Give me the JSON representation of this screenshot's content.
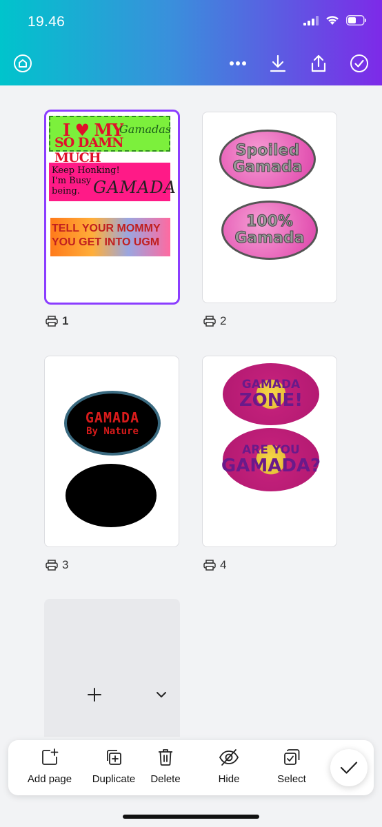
{
  "status_bar": {
    "time": "19.46"
  },
  "pages": [
    {
      "number": "1",
      "selected": true
    },
    {
      "number": "2",
      "selected": false
    },
    {
      "number": "3",
      "selected": false
    },
    {
      "number": "4",
      "selected": false
    }
  ],
  "page1": {
    "sticker1_line1": "I ♥ MY",
    "sticker1_script": "Gamadas",
    "sticker1_line2": "SO DAMN MUCH",
    "sticker2_text": "Keep Honking!\nI'm Busy\nbeing.",
    "sticker2_script": "GAMADA",
    "sticker3_text": "TELL YOUR MOMMY\nYOU GET INTO UGM"
  },
  "page2": {
    "oval1_line1": "Spoiled",
    "oval1_line2": "Gamada",
    "oval2_line1": "100%",
    "oval2_line2": "Gamada"
  },
  "page3": {
    "oval1_line1": "GAMADA",
    "oval1_line2": "By Nature"
  },
  "page4": {
    "oval1_line1": "GAMADA",
    "oval1_line2": "ZONE!",
    "oval2_line1": "ARE YOU",
    "oval2_line2": "GAMADA?"
  },
  "toolbar": {
    "add_page": "Add page",
    "duplicate": "Duplicate",
    "delete": "Delete",
    "hide": "Hide",
    "select": "Select"
  },
  "colors": {
    "accent": "#8b3dff",
    "header_start": "#00c4cc",
    "header_end": "#7d2ae8"
  }
}
